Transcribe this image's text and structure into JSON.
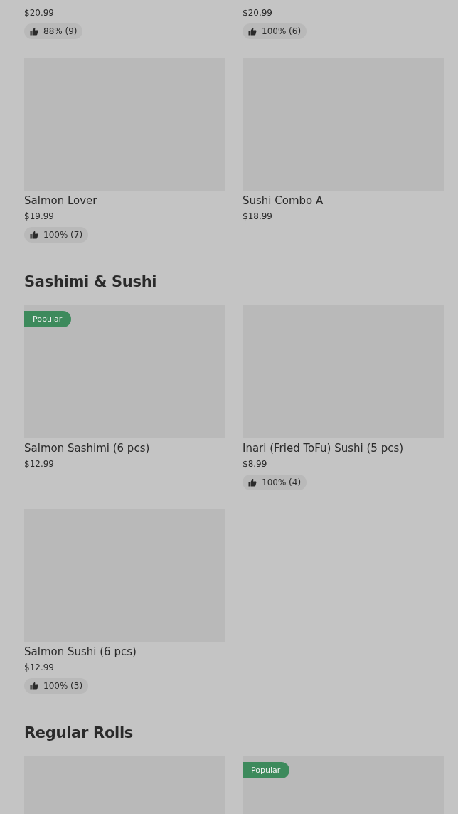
{
  "sections": [
    {
      "items": [
        {
          "kind": "cut",
          "price": "$20.99",
          "rating": "88% (9)"
        },
        {
          "kind": "cut",
          "price": "$20.99",
          "rating": "100% (6)"
        },
        {
          "kind": "card",
          "name": "Salmon Lover",
          "price": "$19.99",
          "rating": "100% (7)"
        },
        {
          "kind": "card",
          "name": "Sushi Combo A",
          "price": "$18.99"
        }
      ]
    },
    {
      "title": "Sashimi & Sushi",
      "items": [
        {
          "kind": "card",
          "name": "Salmon Sashimi (6 pcs)",
          "price": "$12.99",
          "badge": "Popular"
        },
        {
          "kind": "card",
          "name": "Inari (Fried ToFu) Sushi (5 pcs)",
          "price": "$8.99",
          "rating": "100% (4)"
        },
        {
          "kind": "card",
          "name": "Salmon Sushi (6 pcs)",
          "price": "$12.99",
          "rating": "100% (3)"
        }
      ]
    },
    {
      "title": "Regular Rolls",
      "items": [
        {
          "kind": "card"
        },
        {
          "kind": "card",
          "badge": "Popular"
        }
      ]
    }
  ]
}
